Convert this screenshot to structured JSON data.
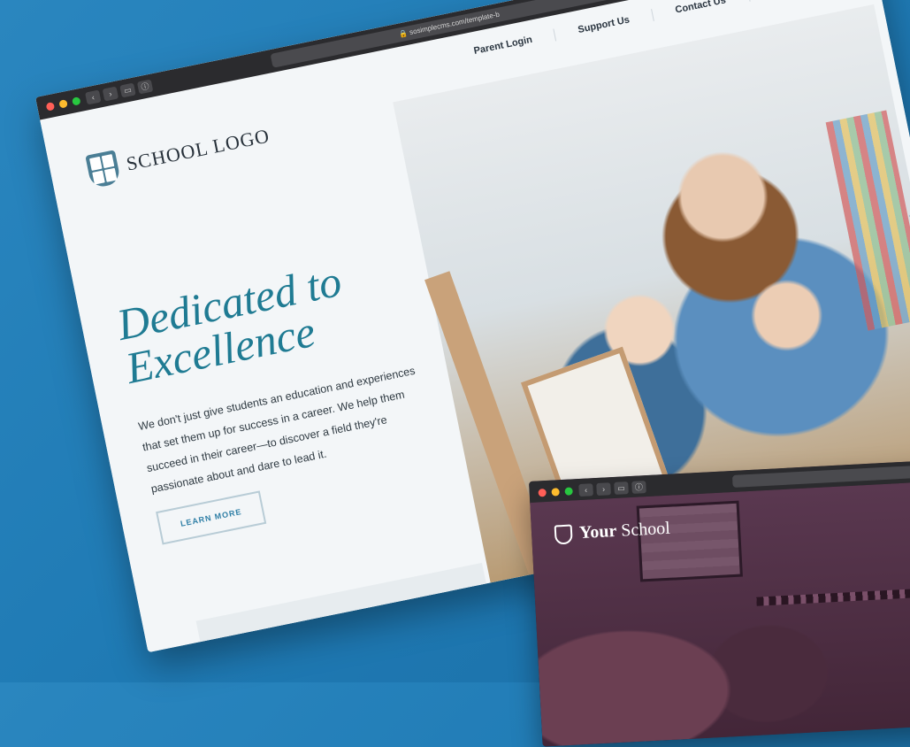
{
  "main_window": {
    "address_url": "sosimplecms.com/template-b",
    "logo_text": "SCHOOL LOGO",
    "nav": {
      "parent_login": "Parent Login",
      "support_us": "Support Us",
      "contact_us": "Contact Us",
      "search_icon": "🔍"
    },
    "hero": {
      "headline_line1": "Dedicated to",
      "headline_line2": "Excellence",
      "body": "We don't just give students an education and experiences that set them up for success in a career. We help them succeed in their career—to discover a field they're passionate about and dare to lead it.",
      "button_label": "LEARN MORE"
    }
  },
  "second_window": {
    "brand_bold": "Your",
    "brand_rest": "School"
  },
  "colors": {
    "background": "#2381bb",
    "accent": "#1f7b93",
    "nav_text": "#2a3540"
  }
}
